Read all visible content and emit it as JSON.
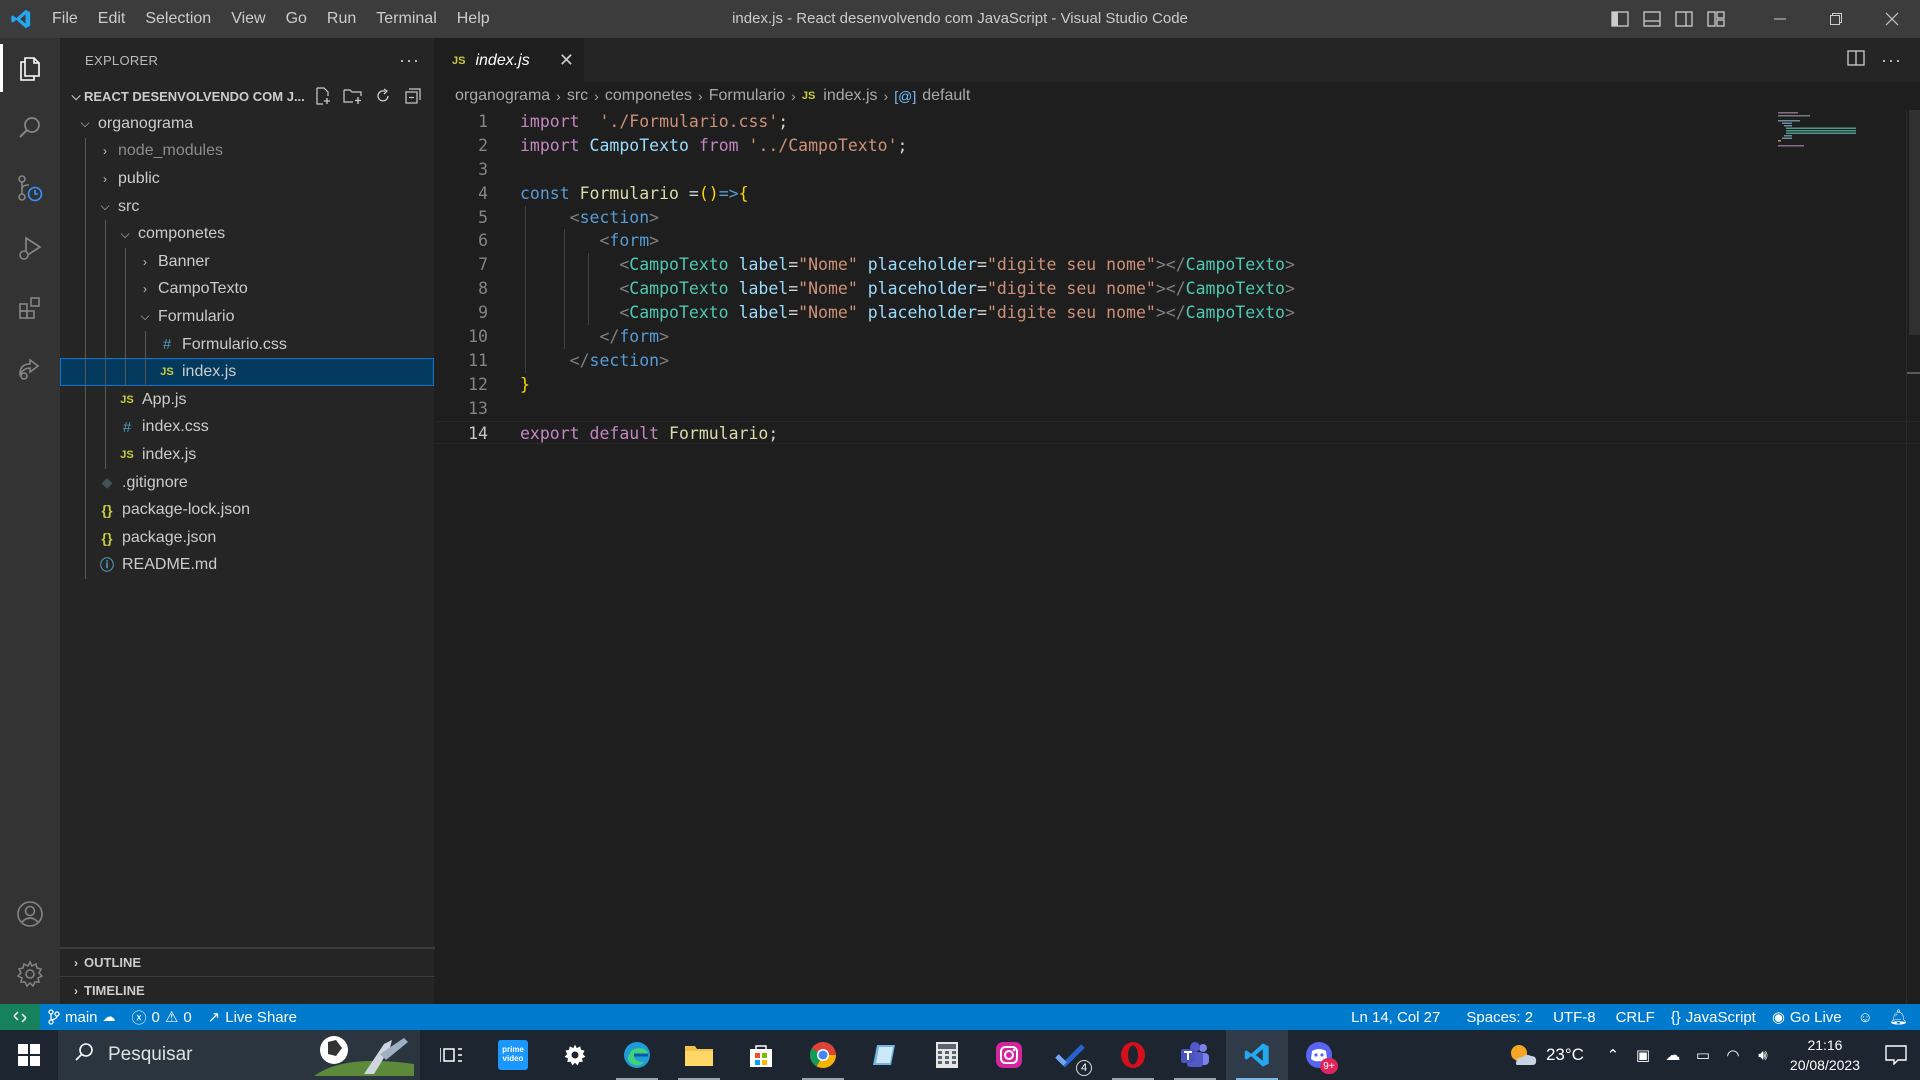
{
  "app": {
    "title": "index.js - React desenvolvendo com JavaScript - Visual Studio Code",
    "menu": [
      "File",
      "Edit",
      "Selection",
      "View",
      "Go",
      "Run",
      "Terminal",
      "Help"
    ]
  },
  "sidebar": {
    "header": "EXPLORER",
    "more": "···",
    "folder_title": "REACT DESENVOLVENDO COM J...",
    "tree": [
      {
        "label": "organograma",
        "depth": 0,
        "kind": "folder-open"
      },
      {
        "label": "node_modules",
        "depth": 1,
        "kind": "folder",
        "dim": true
      },
      {
        "label": "public",
        "depth": 1,
        "kind": "folder"
      },
      {
        "label": "src",
        "depth": 1,
        "kind": "folder-open"
      },
      {
        "label": "componetes",
        "depth": 2,
        "kind": "folder-open"
      },
      {
        "label": "Banner",
        "depth": 3,
        "kind": "folder"
      },
      {
        "label": "CampoTexto",
        "depth": 3,
        "kind": "folder"
      },
      {
        "label": "Formulario",
        "depth": 3,
        "kind": "folder-open"
      },
      {
        "label": "Formulario.css",
        "depth": 4,
        "kind": "css"
      },
      {
        "label": "index.js",
        "depth": 4,
        "kind": "js",
        "selected": true
      },
      {
        "label": "App.js",
        "depth": 2,
        "kind": "js"
      },
      {
        "label": "index.css",
        "depth": 2,
        "kind": "css"
      },
      {
        "label": "index.js",
        "depth": 2,
        "kind": "js"
      },
      {
        "label": ".gitignore",
        "depth": 1,
        "kind": "git"
      },
      {
        "label": "package-lock.json",
        "depth": 1,
        "kind": "json"
      },
      {
        "label": "package.json",
        "depth": 1,
        "kind": "json"
      },
      {
        "label": "README.md",
        "depth": 1,
        "kind": "info"
      }
    ],
    "outline": "OUTLINE",
    "timeline": "TIMELINE"
  },
  "editor": {
    "tab_label": "index.js",
    "tab_badge": "JS",
    "breadcrumb": [
      "organograma",
      "src",
      "componetes",
      "Formulario",
      "index.js",
      "default"
    ],
    "lines": [
      {
        "n": "1",
        "tokens": [
          [
            "k",
            "import"
          ],
          [
            "",
            "  "
          ],
          [
            "s",
            "'./Formulario.css'"
          ],
          [
            "",
            ";"
          ]
        ]
      },
      {
        "n": "2",
        "tokens": [
          [
            "k",
            "import"
          ],
          [
            "",
            " "
          ],
          [
            "v",
            "CampoTexto"
          ],
          [
            "",
            " "
          ],
          [
            "k",
            "from"
          ],
          [
            "",
            " "
          ],
          [
            "s",
            "'../CampoTexto'"
          ],
          [
            "",
            ";"
          ]
        ]
      },
      {
        "n": "3",
        "tokens": []
      },
      {
        "n": "4",
        "tokens": [
          [
            "kb",
            "const"
          ],
          [
            "",
            " "
          ],
          [
            "f",
            "Formulario"
          ],
          [
            "",
            " "
          ],
          [
            "",
            "="
          ],
          [
            "br",
            "()"
          ],
          [
            "kb",
            "=>"
          ],
          [
            "br",
            "{"
          ]
        ]
      },
      {
        "n": "5",
        "tokens": [
          [
            "",
            "     "
          ],
          [
            "p",
            "<"
          ],
          [
            "kb",
            "section"
          ],
          [
            "p",
            ">"
          ]
        ]
      },
      {
        "n": "6",
        "tokens": [
          [
            "",
            "        "
          ],
          [
            "p",
            "<"
          ],
          [
            "kb",
            "form"
          ],
          [
            "p",
            ">"
          ]
        ]
      },
      {
        "n": "7",
        "tokens": [
          [
            "",
            "          "
          ],
          [
            "p",
            "<"
          ],
          [
            "t",
            "CampoTexto"
          ],
          [
            "",
            " "
          ],
          [
            "v",
            "label"
          ],
          [
            "",
            "="
          ],
          [
            "s",
            "\"Nome\""
          ],
          [
            "",
            " "
          ],
          [
            "v",
            "placeholder"
          ],
          [
            "",
            "="
          ],
          [
            "s",
            "\"digite seu nome\""
          ],
          [
            "p",
            "></"
          ],
          [
            "t",
            "CampoTexto"
          ],
          [
            "p",
            ">"
          ]
        ]
      },
      {
        "n": "8",
        "tokens": [
          [
            "",
            "          "
          ],
          [
            "p",
            "<"
          ],
          [
            "t",
            "CampoTexto"
          ],
          [
            "",
            " "
          ],
          [
            "v",
            "label"
          ],
          [
            "",
            "="
          ],
          [
            "s",
            "\"Nome\""
          ],
          [
            "",
            " "
          ],
          [
            "v",
            "placeholder"
          ],
          [
            "",
            "="
          ],
          [
            "s",
            "\"digite seu nome\""
          ],
          [
            "p",
            "></"
          ],
          [
            "t",
            "CampoTexto"
          ],
          [
            "p",
            ">"
          ]
        ]
      },
      {
        "n": "9",
        "tokens": [
          [
            "",
            "          "
          ],
          [
            "p",
            "<"
          ],
          [
            "t",
            "CampoTexto"
          ],
          [
            "",
            " "
          ],
          [
            "v",
            "label"
          ],
          [
            "",
            "="
          ],
          [
            "s",
            "\"Nome\""
          ],
          [
            "",
            " "
          ],
          [
            "v",
            "placeholder"
          ],
          [
            "",
            "="
          ],
          [
            "s",
            "\"digite seu nome\""
          ],
          [
            "p",
            "></"
          ],
          [
            "t",
            "CampoTexto"
          ],
          [
            "p",
            ">"
          ]
        ]
      },
      {
        "n": "10",
        "tokens": [
          [
            "",
            "        "
          ],
          [
            "p",
            "</"
          ],
          [
            "kb",
            "form"
          ],
          [
            "p",
            ">"
          ]
        ]
      },
      {
        "n": "11",
        "tokens": [
          [
            "",
            "     "
          ],
          [
            "p",
            "</"
          ],
          [
            "kb",
            "section"
          ],
          [
            "p",
            ">"
          ]
        ]
      },
      {
        "n": "12",
        "tokens": [
          [
            "br",
            "}"
          ]
        ]
      },
      {
        "n": "13",
        "tokens": []
      },
      {
        "n": "14",
        "tokens": [
          [
            "k",
            "export"
          ],
          [
            "",
            " "
          ],
          [
            "k",
            "default"
          ],
          [
            "",
            " "
          ],
          [
            "f",
            "Formulario"
          ],
          [
            "",
            ";"
          ]
        ],
        "current": true
      }
    ]
  },
  "statusbar": {
    "branch": "main",
    "errors": "0",
    "warnings": "0",
    "live_share": "Live Share",
    "position": "Ln 14, Col 27",
    "spaces": "Spaces: 2",
    "encoding": "UTF-8",
    "eol": "CRLF",
    "language": "JavaScript",
    "go_live": "Go Live"
  },
  "taskbar": {
    "search_placeholder": "Pesquisar",
    "prime_label": "prime video",
    "todo_badge": "4",
    "discord_badge": "9+",
    "temperature": "23°C",
    "time": "21:16",
    "date": "20/08/2023"
  },
  "colors": {
    "accent": "#007acc",
    "remote": "#16825d",
    "selection": "#04395e"
  }
}
